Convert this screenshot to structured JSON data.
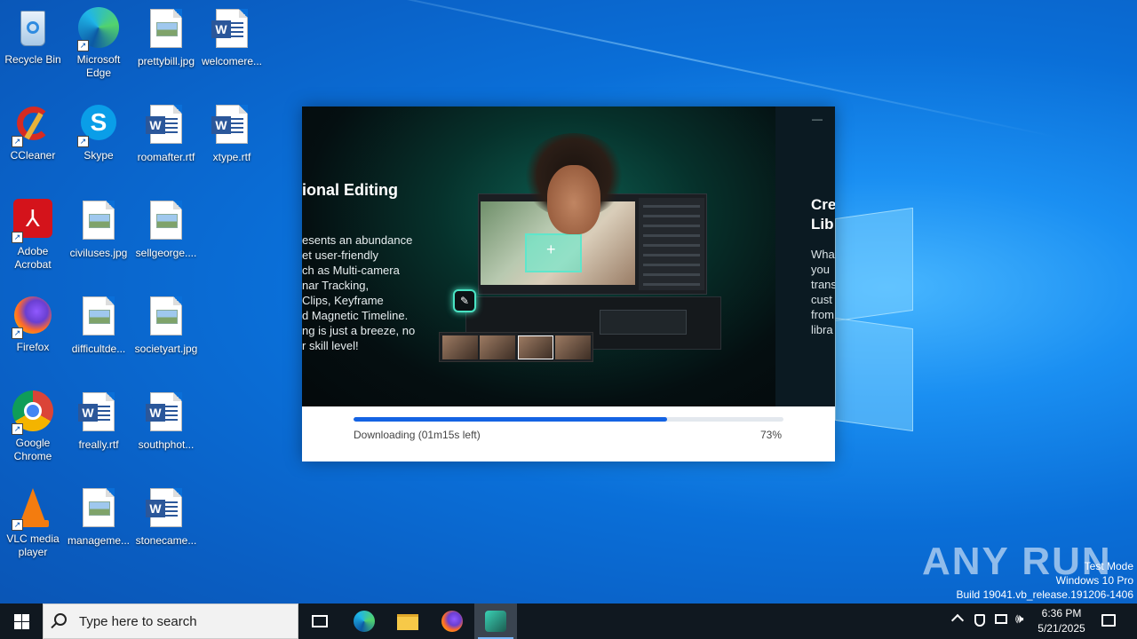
{
  "desktop": {
    "icons": [
      {
        "label": "Recycle Bin"
      },
      {
        "label": "Microsoft Edge"
      },
      {
        "label": "prettybill.jpg"
      },
      {
        "label": "welcomere..."
      },
      {
        "label": "CCleaner"
      },
      {
        "label": "Skype"
      },
      {
        "label": "roomafter.rtf"
      },
      {
        "label": "xtype.rtf"
      },
      {
        "label": "Adobe Acrobat"
      },
      {
        "label": "civiluses.jpg"
      },
      {
        "label": "sellgeorge...."
      },
      {
        "label": "Firefox"
      },
      {
        "label": "difficultde..."
      },
      {
        "label": "societyart.jpg"
      },
      {
        "label": "Google Chrome"
      },
      {
        "label": "freally.rtf"
      },
      {
        "label": "southphot..."
      },
      {
        "label": "VLC media player"
      },
      {
        "label": "manageme..."
      },
      {
        "label": "stonecame..."
      }
    ]
  },
  "installer": {
    "hero_title": "ional Editing",
    "hero_desc_lines": [
      "esents an abundance",
      "et user-friendly",
      "ch as Multi-camera",
      "nar Tracking,",
      "Clips, Keyframe",
      "d Magnetic Timeline.",
      "ng is just a breeze, no",
      "r skill level!"
    ],
    "side_title_lines": [
      "Cre",
      "Lib"
    ],
    "side_desc_lines": [
      "Wha",
      "you",
      "trans",
      "cust",
      "from",
      "libra"
    ],
    "progress_label": "Downloading (01m15s left)",
    "progress_percent_text": "73%",
    "progress_fraction": 0.73,
    "accent_color": "#1463e3"
  },
  "watermark": {
    "brand": "ANY RUN",
    "line1": "Test Mode",
    "line2": "Windows 10 Pro",
    "line3": "Build 19041.vb_release.191206-1406"
  },
  "taskbar": {
    "search_placeholder": "Type here to search",
    "time": "6:36 PM",
    "date": "5/21/2025"
  }
}
